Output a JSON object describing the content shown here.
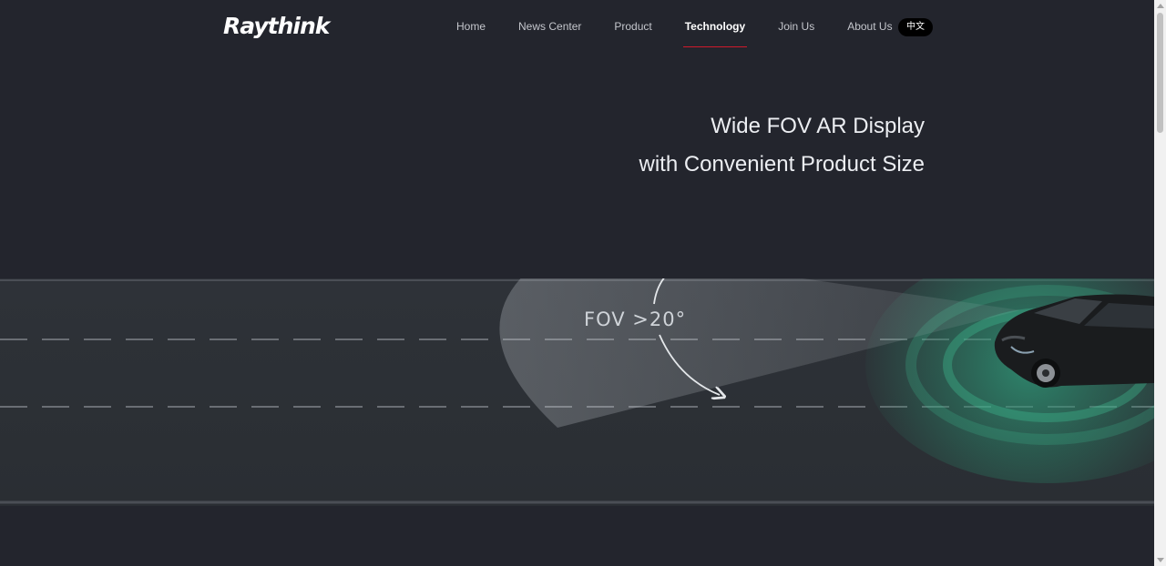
{
  "header": {
    "logo": "Raythink",
    "nav": [
      {
        "label": "Home"
      },
      {
        "label": "News Center"
      },
      {
        "label": "Product"
      },
      {
        "label": "Technology",
        "active": true
      },
      {
        "label": "Join Us"
      },
      {
        "label": "About Us"
      }
    ],
    "lang_button": "中文"
  },
  "hero": {
    "line1": "Wide FOV AR Display",
    "line2": "with Convenient Product Size",
    "fov_label": "FOV >20°"
  },
  "colors": {
    "background": "#23252d",
    "accent": "#d0192b",
    "sensor_glow": "#2fa27e"
  },
  "icons": [
    "scroll-up-icon",
    "scroll-down-icon",
    "car-icon",
    "arc-arrow-icon"
  ]
}
